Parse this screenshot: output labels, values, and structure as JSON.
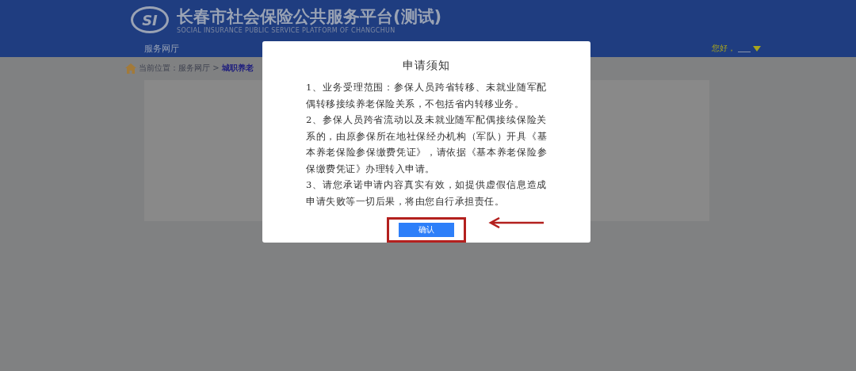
{
  "header": {
    "title": "长春市社会保险公共服务平台(测试)",
    "subtitle": "SOCIAL INSURANCE PUBLIC SERVICE PLATFORM OF CHANGCHUN",
    "logo_text": "SI"
  },
  "nav": {
    "label": "服务网厅",
    "greeting": "您好，"
  },
  "breadcrumb": {
    "prefix": "当前位置：服务网厅 >",
    "current": "城职养老"
  },
  "dialog": {
    "title": "申请须知",
    "paragraphs": [
      "1、业务受理范围：参保人员跨省转移、未就业随军配偶转移接续养老保险关系，不包括省内转移业务。",
      "2、参保人员跨省流动以及未就业随军配偶接续保险关系的，由原参保所在地社保经办机构（军队）开具《基本养老保险参保缴费凭证》，请依据《基本养老保险参保缴费凭证》办理转入申请。",
      "3、请您承诺申请内容真实有效，如提供虚假信息造成申请失败等一切后果，将由您自行承担责任。"
    ],
    "confirm_button": "确认"
  }
}
